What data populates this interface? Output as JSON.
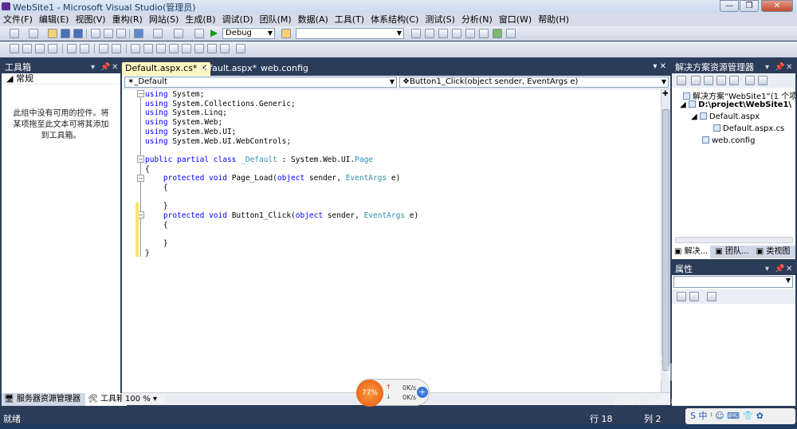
{
  "window": {
    "title": "WebSite1 - Microsoft Visual Studio(管理员)",
    "minimize": "—",
    "restore": "❐",
    "close": "✕"
  },
  "menu": [
    "文件(F)",
    "编辑(E)",
    "视图(V)",
    "重构(R)",
    "网站(S)",
    "生成(B)",
    "调试(D)",
    "团队(M)",
    "数据(A)",
    "工具(T)",
    "体系结构(C)",
    "测试(S)",
    "分析(N)",
    "窗口(W)",
    "帮助(H)"
  ],
  "toolbar": {
    "config": "Debug",
    "find_value": ""
  },
  "toolbox": {
    "title": "工具箱",
    "section": "常规",
    "empty_message": "此组中没有可用的控件。将某项拖至此文本可将其添加到工具箱。",
    "tabs": [
      "服务器资源管理器",
      "工具箱"
    ]
  },
  "editor": {
    "tabs": [
      "Default.aspx.cs*",
      "Default.aspx*",
      "web.config"
    ],
    "class_combo": "_Default",
    "member_combo": "Button1_Click(object sender, EventArgs e)",
    "zoom": "100 %",
    "lines": [
      [
        [
          "kw",
          "using"
        ],
        [
          "t",
          " System;"
        ]
      ],
      [
        [
          "kw",
          "using"
        ],
        [
          "t",
          " System.Collections.Generic;"
        ]
      ],
      [
        [
          "kw",
          "using"
        ],
        [
          "t",
          " System.Linq;"
        ]
      ],
      [
        [
          "kw",
          "using"
        ],
        [
          "t",
          " System.Web;"
        ]
      ],
      [
        [
          "kw",
          "using"
        ],
        [
          "t",
          " System.Web.UI;"
        ]
      ],
      [
        [
          "kw",
          "using"
        ],
        [
          "t",
          " System.Web.UI.WebControls;"
        ]
      ],
      [],
      [
        [
          "kw",
          "public partial class"
        ],
        [
          "t",
          " "
        ],
        [
          "ty",
          "_Default"
        ],
        [
          "t",
          " : System.Web.UI."
        ],
        [
          "ty",
          "Page"
        ]
      ],
      [
        [
          "t",
          "{"
        ]
      ],
      [
        [
          "t",
          "    "
        ],
        [
          "kw",
          "protected void"
        ],
        [
          "t",
          " Page_Load("
        ],
        [
          "kw",
          "object"
        ],
        [
          "t",
          " sender, "
        ],
        [
          "ty",
          "EventArgs"
        ],
        [
          "t",
          " e)"
        ]
      ],
      [
        [
          "t",
          "    {"
        ]
      ],
      [],
      [
        [
          "t",
          "    }"
        ]
      ],
      [
        [
          "t",
          "    "
        ],
        [
          "kw",
          "protected void"
        ],
        [
          "t",
          " Button1_Click("
        ],
        [
          "kw",
          "object"
        ],
        [
          "t",
          " sender, "
        ],
        [
          "ty",
          "EventArgs"
        ],
        [
          "t",
          " e)"
        ]
      ],
      [
        [
          "t",
          "    {"
        ]
      ],
      [],
      [
        [
          "t",
          "    }"
        ]
      ],
      [
        [
          "t",
          "}"
        ]
      ]
    ]
  },
  "solution": {
    "title": "解决方案资源管理器",
    "root": "解决方案“WebSite1”(1 个项目)",
    "project": "D:\\project\\WebSite1\\",
    "items": [
      "Default.aspx",
      "Default.aspx.cs",
      "web.config"
    ],
    "tabs": [
      "解决...",
      "团队...",
      "类视图"
    ]
  },
  "properties": {
    "title": "属性"
  },
  "status": {
    "ready": "就绪",
    "row": "行 18",
    "col": "列 2"
  },
  "widget": {
    "percent": "77%",
    "up": "0K/s",
    "down": "0K/s"
  },
  "watermark": {
    "text": "Baidu 经验",
    "url": "jingyan.baidu.com"
  },
  "tray": {
    "text": "S 中 ⁾ ☺ ⌨ 👕 ✿"
  }
}
